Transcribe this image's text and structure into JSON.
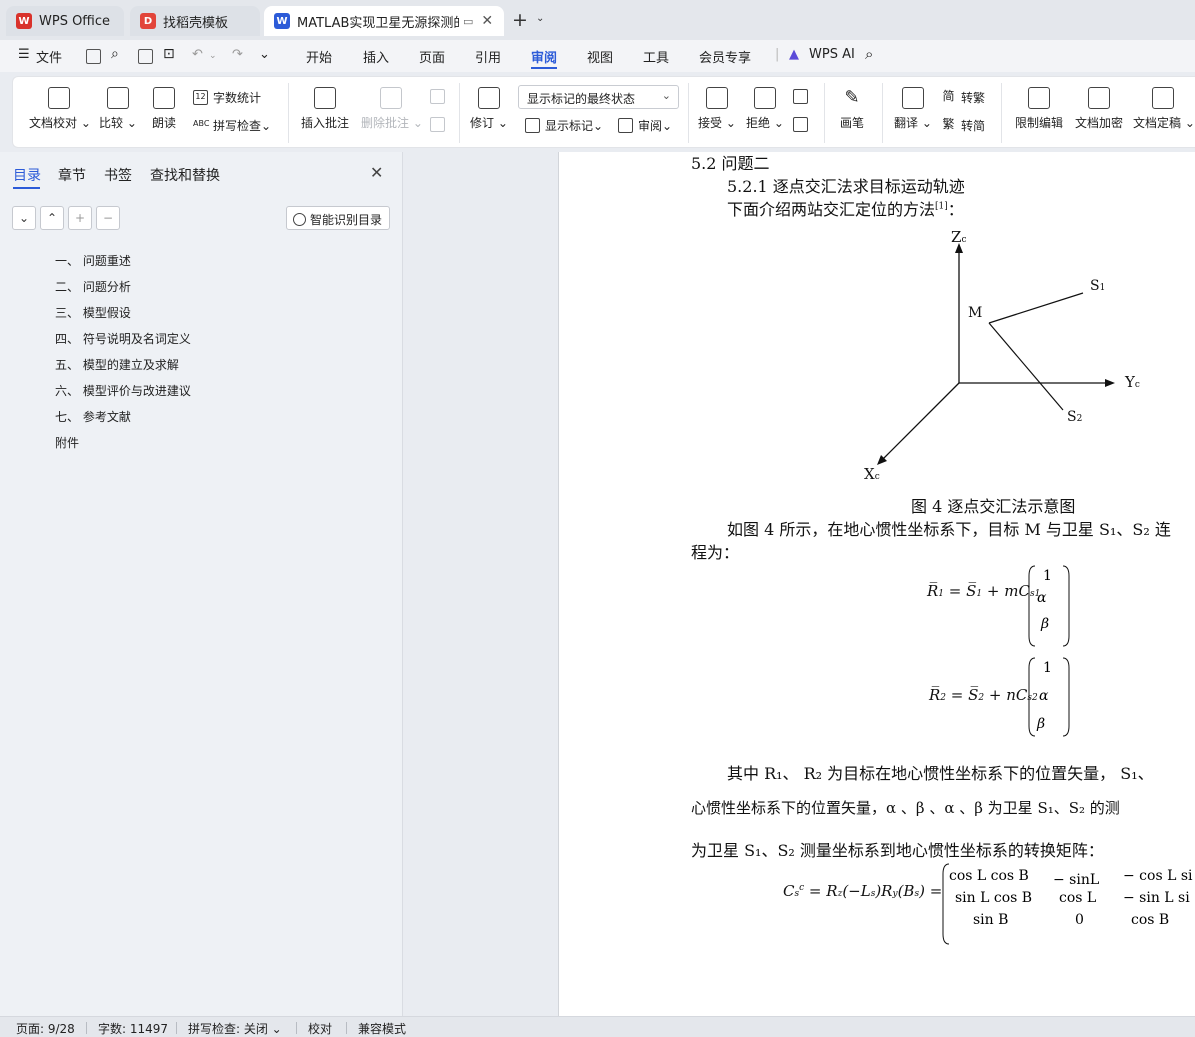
{
  "tabs": [
    {
      "title": "WPS Office",
      "icon": "wps-logo-icon",
      "color": "#d9322b"
    },
    {
      "title": "找稻壳模板",
      "icon": "docer-icon",
      "color": "#e2453a"
    },
    {
      "title": "MATLAB实现卫星无源探测的",
      "icon": "word-doc-icon",
      "color": "#2c5bd8"
    }
  ],
  "menu": {
    "file": "文件",
    "items": [
      "开始",
      "插入",
      "页面",
      "引用",
      "审阅",
      "视图",
      "工具",
      "会员专享"
    ],
    "active": "审阅",
    "wps_ai": "WPS AI"
  },
  "ribbon": {
    "proofread": "文档校对",
    "compare": "比较",
    "read_aloud": "朗读",
    "word_count": "字数统计",
    "spell_check": "拼写检查",
    "insert_comment": "插入批注",
    "delete_comment": "删除批注",
    "revise": "修订",
    "markup_state": "显示标记的最终状态",
    "show_markup": "显示标记",
    "review": "审阅",
    "accept": "接受",
    "reject": "拒绝",
    "pen": "画笔",
    "translate": "翻译",
    "to_traditional": "转繁",
    "to_simplified": "转简",
    "restrict_edit": "限制编辑",
    "encrypt": "文档加密",
    "finalize": "文档定稿"
  },
  "left_panel": {
    "tabs": [
      "目录",
      "章节",
      "书签",
      "查找和替换"
    ],
    "active_tab": "目录",
    "ai_toc": "智能识别目录",
    "toc": [
      "一、 问题重述",
      "二、 问题分析",
      "三、 模型假设",
      "四、 符号说明及名词定义",
      "五、 模型的建立及求解",
      "六、 模型评价与改进建议",
      "七、 参考文献",
      "附件"
    ]
  },
  "document": {
    "heading": "5.2  问题二",
    "subheading": "5.2.1      逐点交汇法求目标运动轨迹",
    "intro": "下面介绍两站交汇定位的方法",
    "ref": "[1]",
    "intro_end": "：",
    "figure_labels": {
      "z": "Z",
      "y": "Y",
      "x": "X",
      "c": "c",
      "m": "M",
      "s1": "S",
      "s1_sub": "1",
      "s2": "S",
      "s2_sub": "2"
    },
    "caption": "图 4      逐点交汇法示意图",
    "para1": "如图 4 所示，在地心惯性坐标系下，目标 M 与卫星 S₁、S₂ 连",
    "para1b": "程为：",
    "para2": "其中  R₁、  R₂ 为目标在地心惯性坐标系下的位置矢量，   S₁、",
    "para3": "心惯性坐标系下的位置矢量，α   、β   、α   、β   为卫星 S₁、S₂ 的测",
    "para4": "为卫星  S₁、S₂ 测量坐标系到地心惯性坐标系的转换矩阵："
  },
  "status": {
    "page": "页面: 9/28",
    "words": "字数: 11497",
    "spell": "拼写检查: 关闭",
    "proof": "校对",
    "compat": "兼容模式"
  }
}
